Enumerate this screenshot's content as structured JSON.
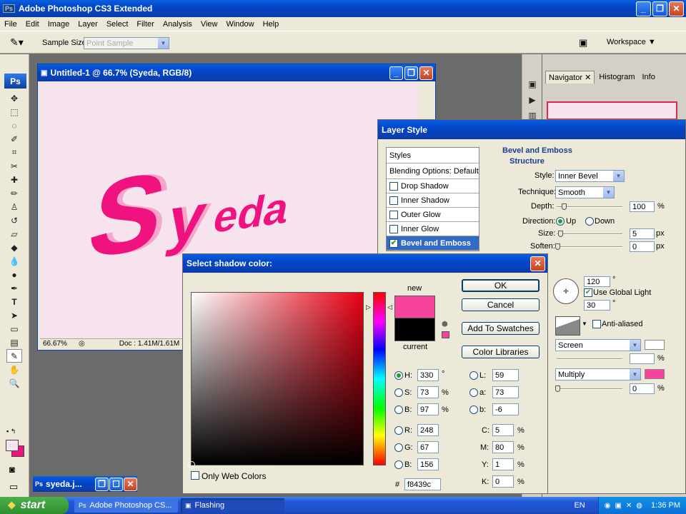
{
  "app": {
    "title": "Adobe Photoshop CS3 Extended",
    "ps_badge": "Ps"
  },
  "menu": [
    "File",
    "Edit",
    "Image",
    "Layer",
    "Select",
    "Filter",
    "Analysis",
    "View",
    "Window",
    "Help"
  ],
  "options": {
    "sample_size_label": "Sample Size:",
    "sample_size_value": "Point Sample",
    "workspace_label": "Workspace"
  },
  "doc": {
    "title": "Untitled-1 @ 66.7% (Syeda, RGB/8)",
    "zoom": "66.67%",
    "docsize": "Doc : 1.41M/1.61M",
    "text": "Syeda",
    "canvas_color": "#f7e3ee",
    "text_color": "#f0127f"
  },
  "minimized": {
    "title": "syeda.j...",
    "badge": "Ps"
  },
  "panels": {
    "tabs": [
      "Navigator",
      "Histogram",
      "Info"
    ]
  },
  "layer_style": {
    "title": "Layer Style",
    "styles_header": "Styles",
    "blending": "Blending Options: Default",
    "items": [
      {
        "label": "Drop Shadow",
        "checked": false
      },
      {
        "label": "Inner Shadow",
        "checked": false
      },
      {
        "label": "Outer Glow",
        "checked": false
      },
      {
        "label": "Inner Glow",
        "checked": false
      },
      {
        "label": "Bevel and Emboss",
        "checked": true
      }
    ],
    "section": "Bevel and Emboss",
    "structure": "Structure",
    "style_label": "Style:",
    "style_value": "Inner Bevel",
    "technique_label": "Technique:",
    "technique_value": "Smooth",
    "depth_label": "Depth:",
    "depth_value": "100",
    "depth_unit": "%",
    "direction_label": "Direction:",
    "dir_up": "Up",
    "dir_down": "Down",
    "size_label": "Size:",
    "size_value": "5",
    "size_unit": "px",
    "soften_label": "Soften:",
    "soften_value": "0",
    "soften_unit": "px",
    "angle_value": "120",
    "global_light": "Use Global Light",
    "altitude_value": "30",
    "degree": "°",
    "anti_aliased": "Anti-aliased",
    "highlight_mode": "Screen",
    "highlight_opacity": "",
    "shadow_mode": "Multiply",
    "shadow_opacity": "0",
    "pct": "%",
    "highlight_color": "#ffffff",
    "shadow_color": "#f8439c"
  },
  "picker": {
    "title": "Select shadow color:",
    "new_label": "new",
    "current_label": "current",
    "new_color": "#f8439c",
    "current_color": "#000000",
    "ok": "OK",
    "cancel": "Cancel",
    "add_swatches": "Add To Swatches",
    "libraries": "Color Libraries",
    "H": {
      "label": "H:",
      "value": "330",
      "unit": "°"
    },
    "S": {
      "label": "S:",
      "value": "73",
      "unit": "%"
    },
    "B": {
      "label": "B:",
      "value": "97",
      "unit": "%"
    },
    "R": {
      "label": "R:",
      "value": "248"
    },
    "G": {
      "label": "G:",
      "value": "67"
    },
    "Bl": {
      "label": "B:",
      "value": "156"
    },
    "L": {
      "label": "L:",
      "value": "59"
    },
    "a": {
      "label": "a:",
      "value": "73"
    },
    "b": {
      "label": "b:",
      "value": "-6"
    },
    "C": {
      "label": "C:",
      "value": "5",
      "unit": "%"
    },
    "M": {
      "label": "M:",
      "value": "80",
      "unit": "%"
    },
    "Y": {
      "label": "Y:",
      "value": "1",
      "unit": "%"
    },
    "K": {
      "label": "K:",
      "value": "0",
      "unit": "%"
    },
    "hex_label": "#",
    "hex": "f8439c",
    "web_only": "Only Web Colors"
  },
  "taskbar": {
    "start": "start",
    "items": [
      "Adobe Photoshop CS...",
      "Flashing"
    ],
    "lang": "EN",
    "time": "1:36 PM"
  }
}
